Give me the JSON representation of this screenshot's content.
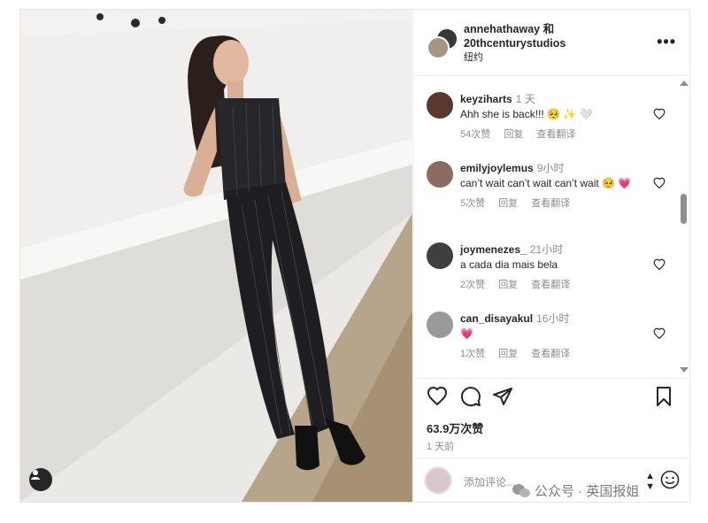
{
  "post": {
    "author_line1": "annehathaway 和",
    "author_line2": "20thcenturystudios",
    "location": "纽约",
    "more_icon": "more-horizontal-icon"
  },
  "comments": [
    {
      "user": "keyziharts",
      "time": "1 天",
      "text": "Ahh she is back!!! 🥺 ✨ 🤍",
      "likes": "54次赞",
      "reply": "回复",
      "translate": "查看翻译",
      "avatar_color": "#5a3a2e"
    },
    {
      "user": "emilyjoylemus",
      "time": "9小时",
      "text": "can’t wait can’t wait can’t wait 🥺 💗",
      "likes": "5次赞",
      "reply": "回复",
      "translate": "查看翻译",
      "avatar_color": "#8b6b62"
    },
    {
      "user": "joymenezes_",
      "time": "21小时",
      "text": "a cada dia mais bela",
      "likes": "2次赞",
      "reply": "回复",
      "translate": "查看翻译",
      "avatar_color": "#3f3f3f"
    },
    {
      "user": "can_disayakul",
      "time": "16小时",
      "text": "💗",
      "likes": "1次赞",
      "reply": "回复",
      "translate": "查看翻译",
      "avatar_color": "#9a9a9a"
    }
  ],
  "actions": {
    "likes": "63.9万次赞",
    "posted": "1 天前"
  },
  "add_comment": {
    "placeholder": "添加评论..."
  },
  "watermark": {
    "text": "公众号 · 英国报姐"
  }
}
